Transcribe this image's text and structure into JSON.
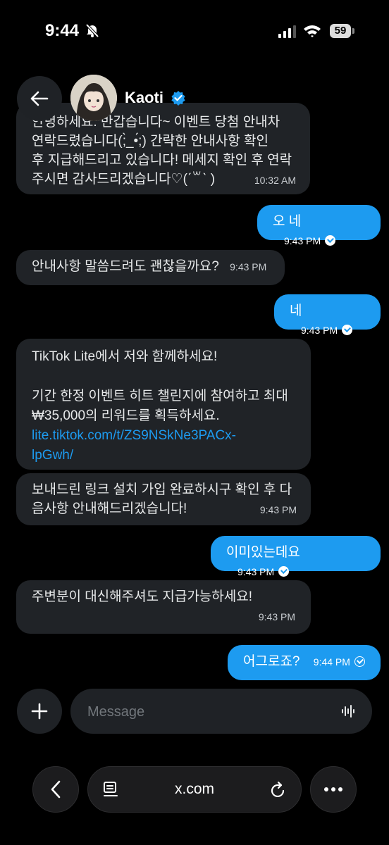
{
  "status_bar": {
    "time": "9:44",
    "battery": "59"
  },
  "header": {
    "name": "Kaoti"
  },
  "messages": [
    {
      "dir": "in",
      "lines": [
        "안녕하세요. 반갑습니다~ 이벤트 당첨 안내차",
        "연락드렸습니다(;̀_•́;) 간략한 안내사항 확인",
        "후 지급해드리고 있습니다! 메세지 확인 후 연락",
        "주시면 감사드리겠습니다♡(ˊ꒳ˋ )"
      ],
      "time": "10:32 AM"
    },
    {
      "dir": "out",
      "text": "오 네",
      "time": "9:43 PM"
    },
    {
      "dir": "in",
      "text": "안내사항 말씀드려도 괜찮을까요?",
      "time": "9:43 PM"
    },
    {
      "dir": "out",
      "text": "네",
      "time": "9:43 PM"
    },
    {
      "dir": "in",
      "line1": "TikTok Lite에서 저와 함께하세요!",
      "line2": "기간 한정 이벤트 히트 챌린지에 참여하고 최대",
      "line3": "₩35,000의 리워드를 획득하세요.",
      "link1": "lite.tiktok.com/t/ZS9NSkNe3PACx-",
      "link2": "lpGwh/"
    },
    {
      "dir": "in",
      "line1": "보내드린 링크 설치 가입 완료하시구 확인 후 다",
      "line2": "음사항 안내해드리겠습니다!",
      "time": "9:43 PM"
    },
    {
      "dir": "out",
      "text": "이미있는데요",
      "time": "9:43 PM"
    },
    {
      "dir": "in",
      "text": "주변분이 대신해주셔도 지급가능하세요!",
      "time": "9:43 PM"
    },
    {
      "dir": "out",
      "text": "어그로죠?",
      "time": "9:44 PM"
    }
  ],
  "composer": {
    "placeholder": "Message"
  },
  "browser": {
    "url": "x.com"
  },
  "colors": {
    "accent": "#1d9bf0",
    "incoming_bubble": "#202327",
    "background": "#000000"
  }
}
